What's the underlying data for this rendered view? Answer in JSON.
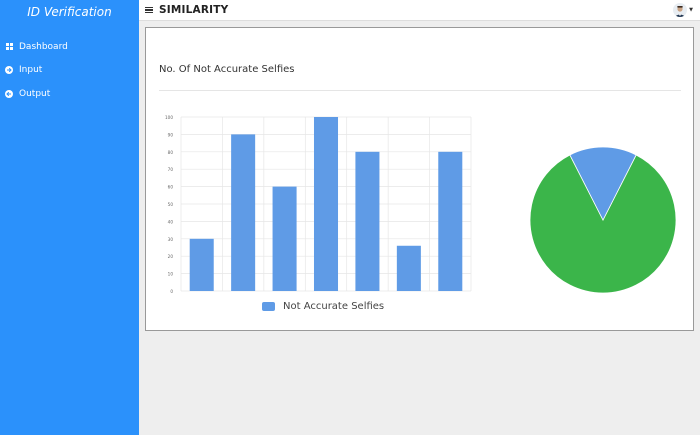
{
  "sidebar": {
    "brand": "ID Verification",
    "items": [
      {
        "label": "Dashboard",
        "icon": "dashboard-icon"
      },
      {
        "label": "Input",
        "icon": "arrow-right-circle-icon"
      },
      {
        "label": "Output",
        "icon": "arrow-left-circle-icon"
      }
    ]
  },
  "header": {
    "title": "SIMILARITY",
    "menu_icon": "hamburger-icon",
    "user_icon": "avatar"
  },
  "card": {
    "title": "No. Of Not Accurate Selfies"
  },
  "colors": {
    "sidebar": "#2b91fb",
    "bar": "#5f9be6",
    "pie_main": "#3bb54a",
    "pie_slice": "#5f9be6"
  },
  "chart_data": [
    {
      "type": "bar",
      "categories": [
        "",
        "",
        "",
        "",
        "",
        "",
        ""
      ],
      "series": [
        {
          "name": "Not Accurate Selfies",
          "values": [
            30,
            90,
            60,
            100,
            80,
            26,
            80
          ]
        }
      ],
      "yticks": [
        0,
        10,
        20,
        30,
        40,
        50,
        60,
        70,
        80,
        90,
        100
      ],
      "ylim": [
        0,
        100
      ],
      "grid": true,
      "legend_position": "bottom"
    },
    {
      "type": "pie",
      "slices": [
        {
          "value": 85,
          "color": "#3bb54a"
        },
        {
          "value": 15,
          "color": "#5f9be6"
        }
      ]
    }
  ]
}
